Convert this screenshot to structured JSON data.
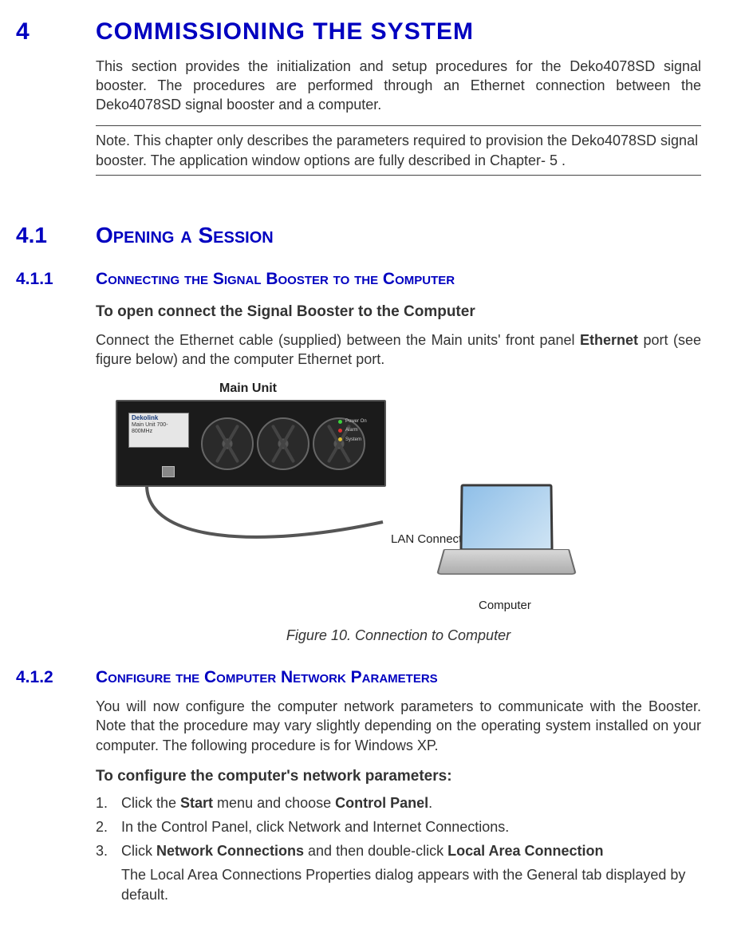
{
  "chapter": {
    "num": "4",
    "title": "COMMISSIONING THE SYSTEM"
  },
  "intro": "This section provides the initialization and setup procedures for the Deko4078SD signal booster. The procedures are performed through an Ethernet connection between the Deko4078SD signal booster and a computer.",
  "note": "Note. This chapter only describes the parameters required to provision the Deko4078SD signal booster. The application window options are fully described in Chapter- 5 .",
  "s41": {
    "num": "4.1",
    "title": "Opening a Session"
  },
  "s411": {
    "num": "4.1.1",
    "title": "Connecting the Signal Booster to the Computer",
    "subhead": "To open connect the Signal Booster to the Computer",
    "p_before": "Connect the Ethernet cable (supplied) between the Main units' front panel ",
    "p_bold": "Ethernet",
    "p_after": " port (see figure below) and the computer Ethernet port."
  },
  "figure": {
    "main_unit_label": "Main Unit",
    "brand": "Dekolink",
    "model": "Main Unit 700-800MHz",
    "lan_label": "LAN Connection",
    "computer_label": "Computer",
    "leds": [
      {
        "label": "Power On",
        "color": "#3bd23b"
      },
      {
        "label": "Alarm",
        "color": "#e03030"
      },
      {
        "label": "System",
        "color": "#e0c030"
      }
    ],
    "caption": "Figure 10. Connection to Computer"
  },
  "s412": {
    "num": "4.1.2",
    "title": "Configure the Computer Network Parameters",
    "intro": "You will now configure the computer network parameters to communicate with the Booster. Note that the procedure may vary slightly depending on the operating system installed on your computer. The following procedure is for Windows XP.",
    "subhead": "To configure the computer's network parameters:",
    "steps": {
      "s1_before": "Click the ",
      "s1_b1": "Start",
      "s1_mid": " menu and choose ",
      "s1_b2": "Control Panel",
      "s1_after": ".",
      "s2": "In the Control Panel, click Network and Internet Connections.",
      "s3_before": "Click ",
      "s3_b1": "Network Connections",
      "s3_mid": " and then double-click ",
      "s3_b2": "Local Area Connection",
      "s3_follow": "The Local Area Connections Properties dialog appears with the General tab displayed by default."
    }
  }
}
